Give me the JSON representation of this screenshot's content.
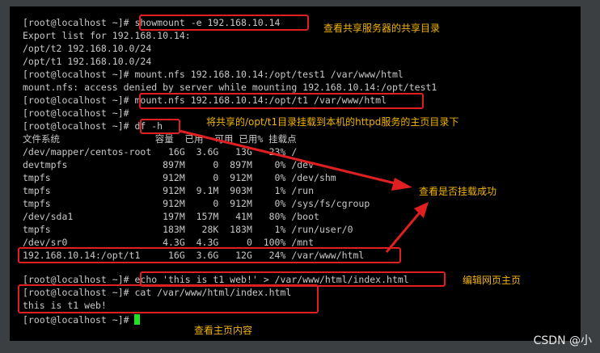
{
  "terminal": {
    "lines": [
      "[root@localhost ~]# showmount -e 192.168.10.14",
      "Export list for 192.168.10.14:",
      "/opt/t2 192.168.10.0/24",
      "/opt/t1 192.168.10.0/24",
      "[root@localhost ~]# mount.nfs 192.168.10.14:/opt/test1 /var/www/html",
      "mount.nfs: access denied by server while mounting 192.168.10.14:/opt/test1",
      "[root@localhost ~]# mount.nfs 192.168.10.14:/opt/t1 /var/www/html",
      "[root@localhost ~]#",
      "[root@localhost ~]# df -h",
      "文件系统                 容量  已用  可用 已用% 挂载点",
      "/dev/mapper/centos-root   16G  3.6G   13G   23% /",
      "devtmpfs                 897M     0  897M    0% /dev",
      "tmpfs                    912M     0  912M    0% /dev/shm",
      "tmpfs                    912M  9.1M  903M    1% /run",
      "tmpfs                    912M     0  912M    0% /sys/fs/cgroup",
      "/dev/sda1                197M  157M   41M   80% /boot",
      "tmpfs                    183M   28K  183M    1% /run/user/0",
      "/dev/sr0                 4.3G  4.3G     0  100% /mnt",
      "192.168.10.14:/opt/t1     16G  3.6G   12G   24% /var/www/html",
      "[root@localhost ~]# echo 'this is t1 web!' > /var/www/html/index.html",
      "[root@localhost ~]# cat /var/www/html/index.html",
      "this is t1 web!",
      "[root@localhost ~]# "
    ]
  },
  "annotations": {
    "showmount": "查看共享服务器的共享目录",
    "mount": "将共享的/opt/t1目录挂载到本机的httpd服务的主页目录下",
    "check": "查看是否挂载成功",
    "edit": "编辑网页主页",
    "view": "查看主页内容"
  },
  "watermark": "CSDN @小",
  "colors": {
    "box": "#e02020",
    "note": "#f0b400",
    "cursor": "#22e022"
  }
}
